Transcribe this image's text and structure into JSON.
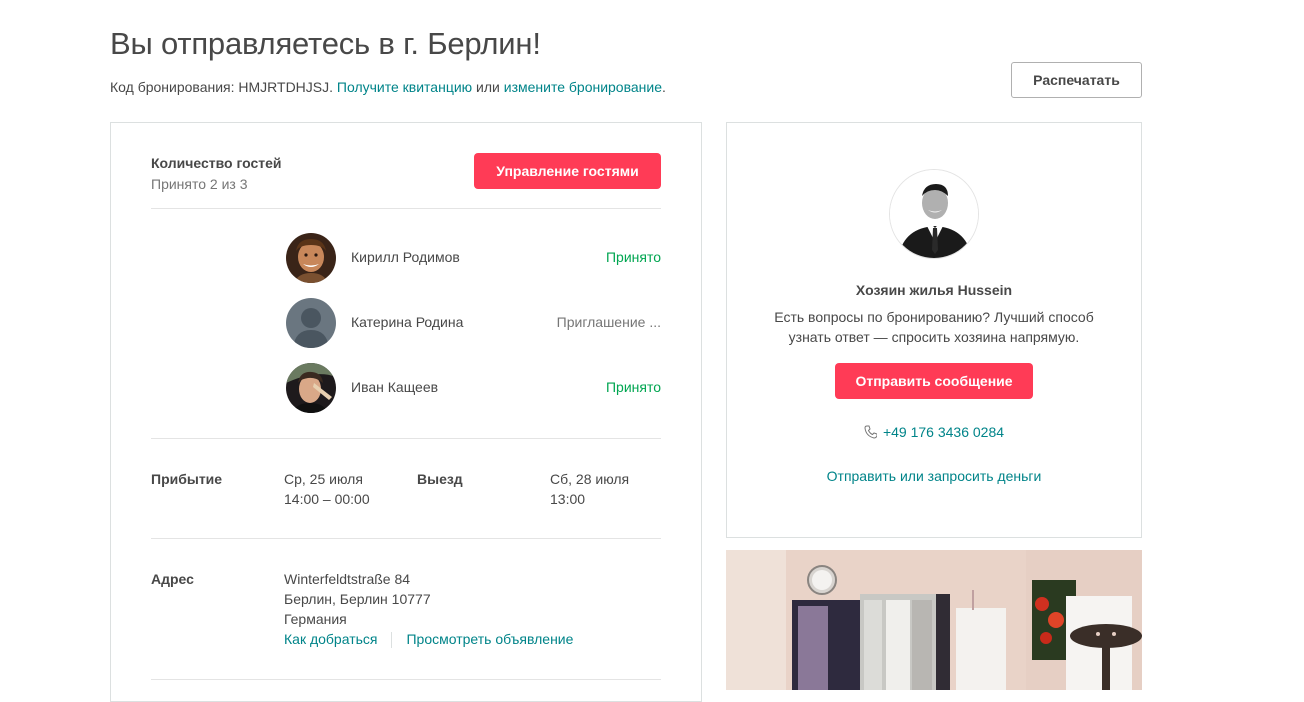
{
  "header": {
    "title": "Вы отправляетесь в г. Берлин!",
    "booking_code_prefix": "Код бронирования: HMJRTDHJSJ.",
    "receipt_link": "Получите квитанцию",
    "or_text": "или",
    "change_link": "измените бронирование",
    "dot": ".",
    "print_label": "Распечатать"
  },
  "guests": {
    "title": "Количество гостей",
    "accepted_count": "Принято 2 из 3",
    "manage_label": "Управление гостями",
    "list": [
      {
        "name": "Кирилл Родимов",
        "status": "Принято"
      },
      {
        "name": "Катерина Родина",
        "status": "Приглашение ..."
      },
      {
        "name": "Иван Кащеев",
        "status": "Принято"
      }
    ]
  },
  "stay": {
    "arrival_label": "Прибытие",
    "arrival_date": "Ср, 25 июля",
    "arrival_time": "14:00 – 00:00",
    "departure_label": "Выезд",
    "departure_date": "Сб, 28 июля",
    "departure_time": "13:00"
  },
  "address": {
    "label": "Адрес",
    "line1": "Winterfeldtstraße 84",
    "line2": "Берлин, Берлин 10777",
    "line3": "Германия",
    "directions_link": "Как добраться",
    "listing_link": "Просмотреть объявление"
  },
  "host": {
    "title": "Хозяин жилья Hussein",
    "desc_line1": "Есть вопросы по бронированию? Лучший способ",
    "desc_line2": "узнать ответ — спросить хозяина напрямую.",
    "message_label": "Отправить сообщение",
    "phone": "+49 176 3436 0284",
    "money_link": "Отправить или запросить деньги"
  },
  "colors": {
    "accent": "#ff3b56",
    "link": "#008489",
    "accepted": "#00a651"
  }
}
